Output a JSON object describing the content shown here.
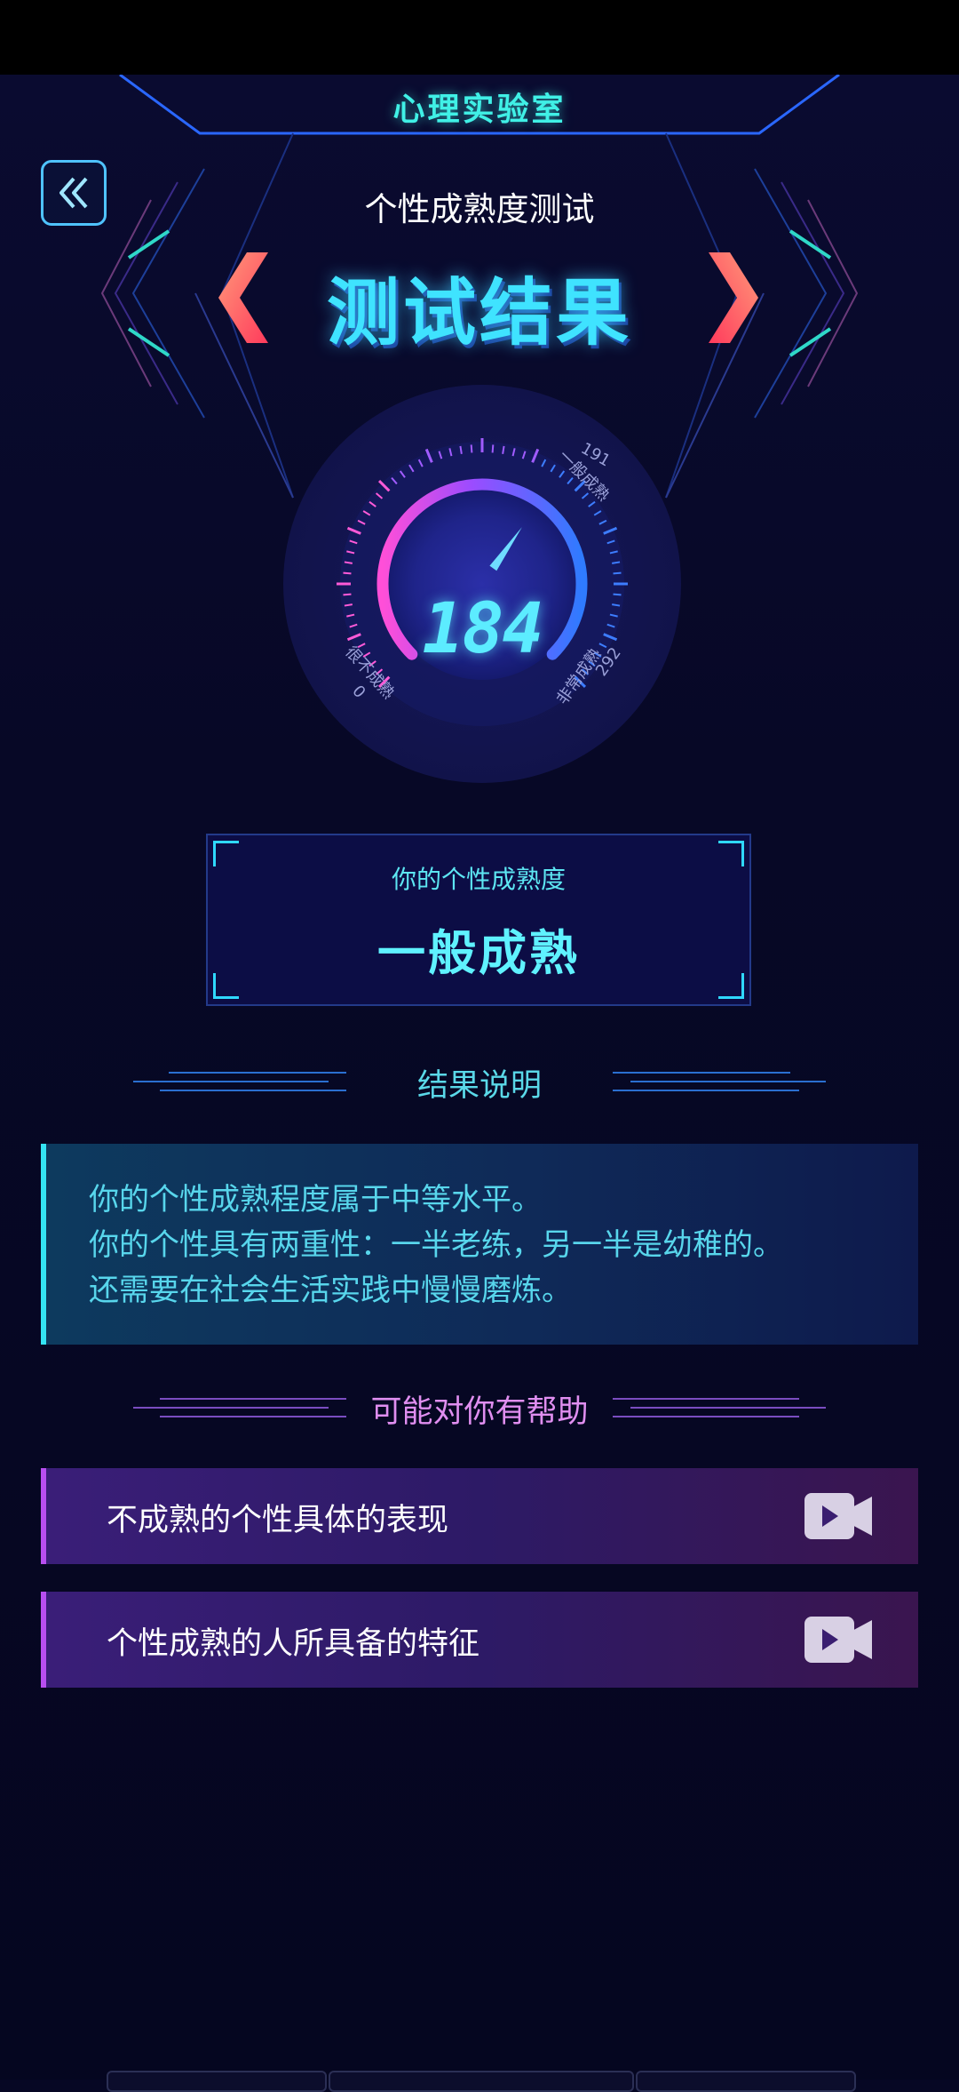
{
  "header": {
    "app_title": "心理实验室",
    "subtitle": "个性成熟度测试",
    "title": "测试结果"
  },
  "gauge": {
    "value": "184",
    "min_label": "0",
    "min_text": "很不成熟",
    "mid_value": "191",
    "mid_text": "一般成熟",
    "max_value": "292",
    "max_text": "非常成熟",
    "fraction": 0.63
  },
  "result": {
    "label": "你的个性成熟度",
    "level": "一般成熟"
  },
  "explanation": {
    "heading": "结果说明",
    "lines": [
      "你的个性成熟程度属于中等水平。",
      "你的个性具有两重性：一半老练，另一半是幼稚的。",
      "还需要在社会生活实践中慢慢磨炼。"
    ]
  },
  "help": {
    "heading": "可能对你有帮助",
    "items": [
      {
        "label": "不成熟的个性具体的表现",
        "icon": "video-icon"
      },
      {
        "label": "个性成熟的人所具备的特征",
        "icon": "video-icon"
      }
    ]
  },
  "colors": {
    "background": "#060724",
    "cyan": "#3fe3ff",
    "purple": "#b84ef0",
    "pink": "#ff6fd8"
  }
}
